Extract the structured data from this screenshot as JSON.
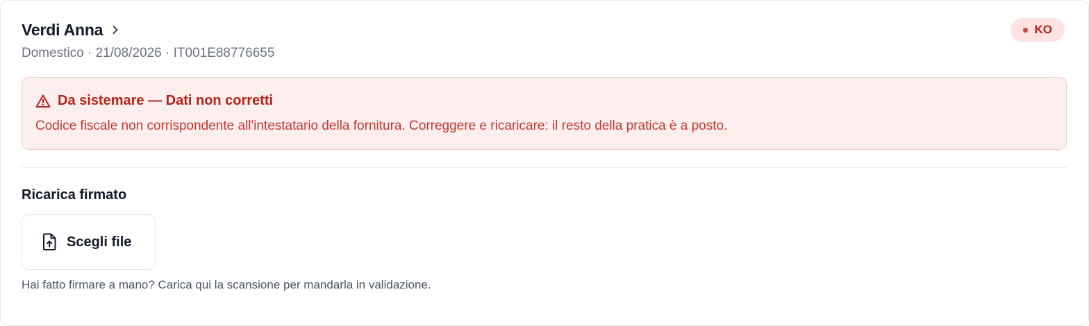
{
  "record": {
    "name": "Verdi Anna",
    "meta": "Domestico · 21/08/2026 · IT001E88776655"
  },
  "status": {
    "label": "KO",
    "color": "#b42318",
    "background": "#fde2e2"
  },
  "alert": {
    "title": "Da sistemare — Dati non corretti",
    "message": "Codice fiscale non corrispondente all'intestatario della fornitura. Correggere e ricaricare: il resto della pratica è a posto.",
    "icon": "warning-triangle-icon"
  },
  "upload": {
    "section_title": "Ricarica firmato",
    "button_label": "Scegli file",
    "button_icon": "file-upload-icon",
    "helper": "Hai fatto firmare a mano? Carica qui la scansione per mandarla in validazione."
  }
}
